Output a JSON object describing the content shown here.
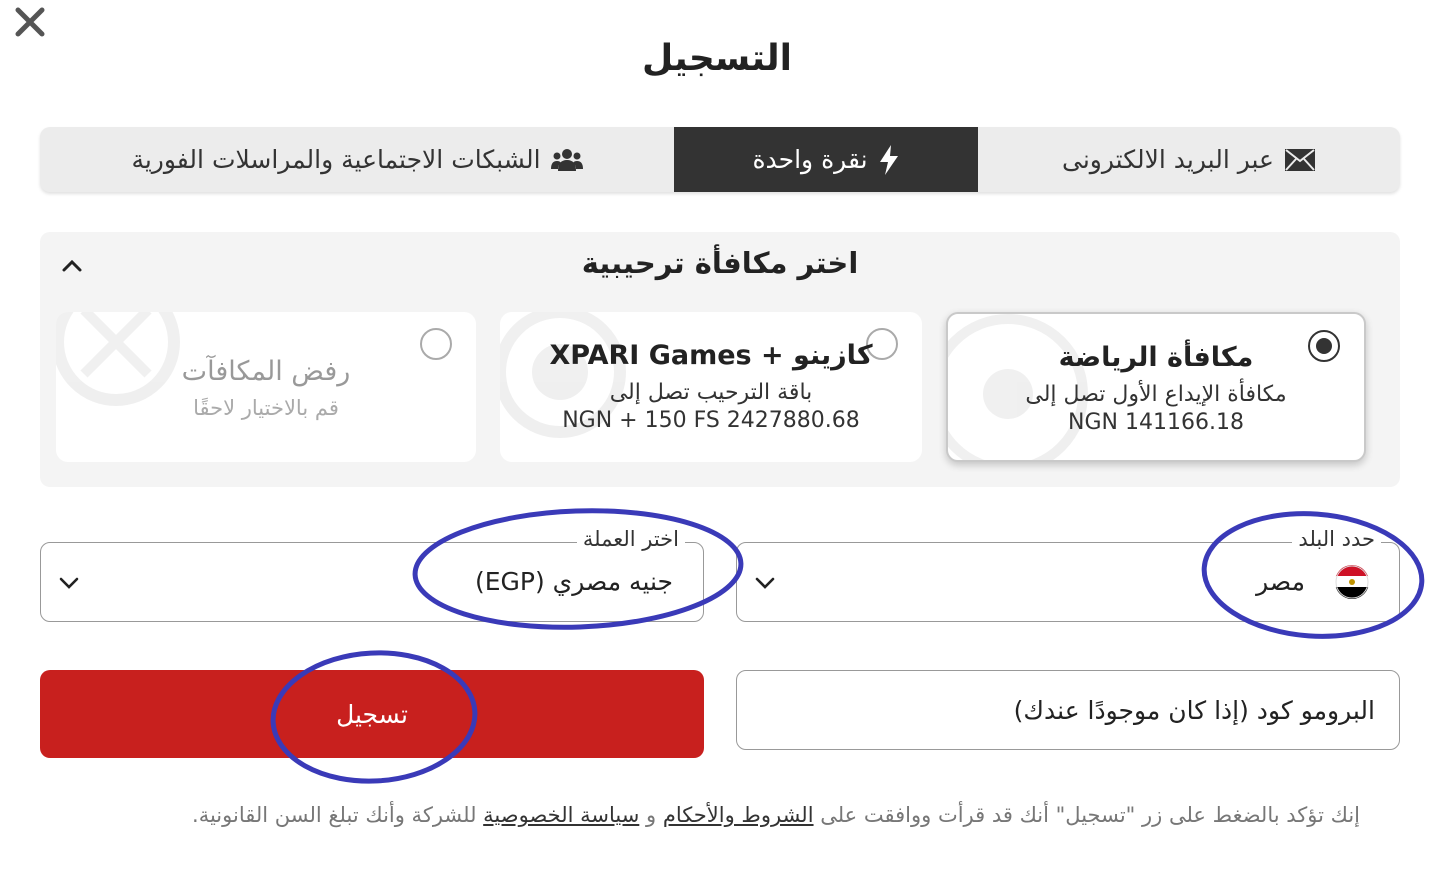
{
  "dialog": {
    "title": "التسجيل"
  },
  "tabs": [
    {
      "label": "عبر البريد الالكترونى",
      "icon": "envelope-icon",
      "active": false
    },
    {
      "label": "نقرة واحدة",
      "icon": "lightning-icon",
      "active": true
    },
    {
      "label": "الشبكات الاجتماعية والمراسلات الفورية",
      "icon": "users-icon",
      "active": false
    }
  ],
  "bonus": {
    "heading": "اختر مكافأة ترحيبية",
    "options": [
      {
        "title": "مكافأة الرياضة",
        "line1": "مكافأة الإيداع الأول تصل إلى",
        "line2": "NGN 141166.18",
        "selected": true
      },
      {
        "title": "كازينو + XPARI Games",
        "line1": "باقة الترحيب تصل إلى",
        "line2": "NGN + 150 FS 2427880.68",
        "selected": false
      },
      {
        "title": "رفض المكافآت",
        "line1": "قم بالاختيار لاحقًا",
        "selected": false
      }
    ]
  },
  "country": {
    "label": "حدد البلد",
    "value": "مصر",
    "flag_colors": [
      "#ce1126",
      "#ffffff",
      "#000000"
    ]
  },
  "currency": {
    "label": "اختر العملة",
    "value": "جنيه مصري (EGP)"
  },
  "promo": {
    "placeholder": "البرومو كود (إذا كان موجودًا عندك)"
  },
  "submit": {
    "label": "تسجيل"
  },
  "disclaimer": {
    "before": "إنك تؤكد بالضغط على زر \"تسجيل\" أنك قد قرأت ووافقت على ",
    "terms_link": "الشروط والأحكام",
    "and": " و ",
    "privacy_link": "سياسة الخصوصية",
    "after": " للشركة وأنك تبلغ السن القانونية."
  },
  "colors": {
    "accent": "#c8201e",
    "active_tab": "#333333",
    "annotation": "#3a3ab8"
  }
}
